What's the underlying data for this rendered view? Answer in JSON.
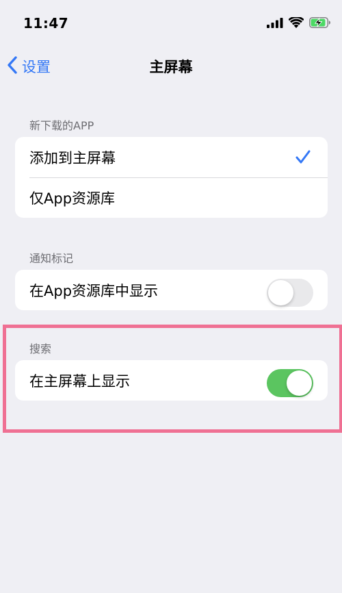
{
  "status_bar": {
    "time": "11:47",
    "icons": [
      "cellular-signal-icon",
      "wifi-icon",
      "battery-charging-icon"
    ],
    "battery_color": "#4cd964",
    "battery_level": 0.8
  },
  "nav": {
    "back_label": "设置",
    "title": "主屏幕",
    "accent_color": "#3478f6"
  },
  "sections": {
    "new_apps": {
      "header": "新下载的APP",
      "options": [
        {
          "label": "添加到主屏幕",
          "selected": true
        },
        {
          "label": "仅App资源库",
          "selected": false
        }
      ]
    },
    "notification_badges": {
      "header": "通知标记",
      "row_label": "在App资源库中显示",
      "toggle_on": false
    },
    "search": {
      "header": "搜索",
      "row_label": "在主屏幕上显示",
      "toggle_on": true,
      "toggle_color": "#5bc560"
    }
  },
  "annotation": {
    "highlight_color": "#ef7093"
  }
}
